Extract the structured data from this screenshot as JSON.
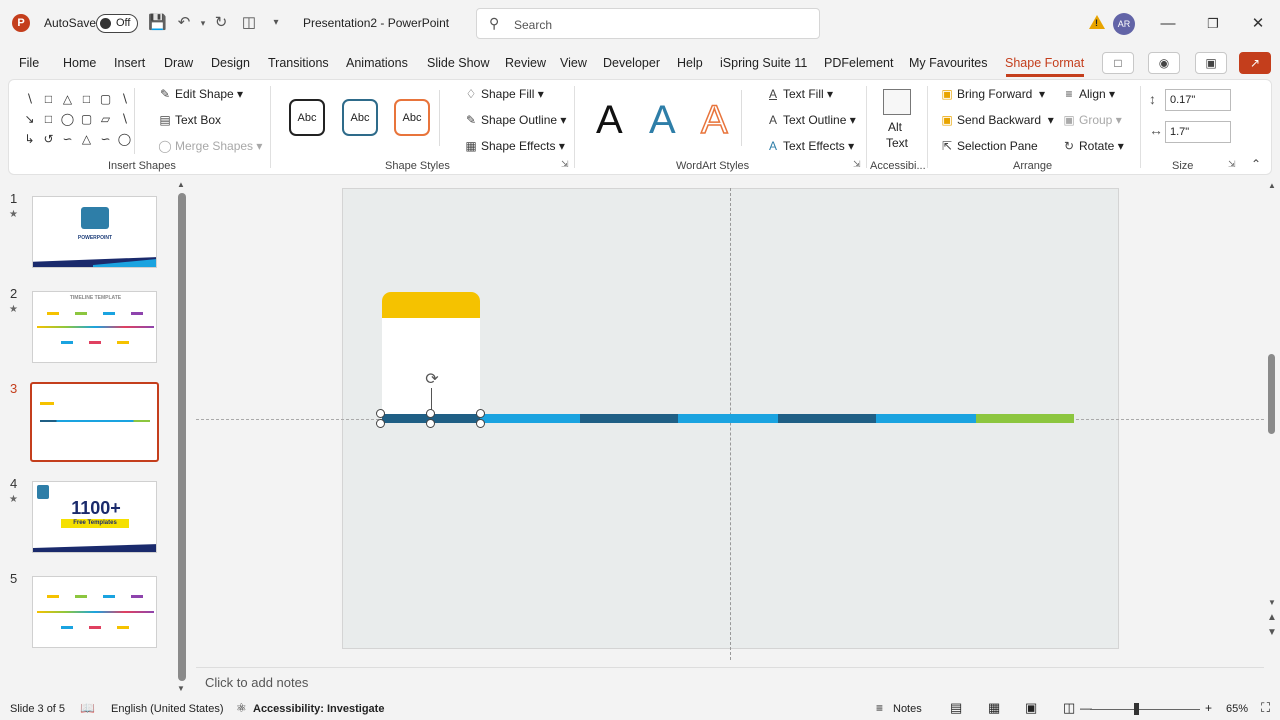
{
  "titlebar": {
    "autosave_label": "AutoSave",
    "autosave_state": "Off",
    "doc_title": "Presentation2 - PowerPoint",
    "search_placeholder": "Search",
    "avatar_initials": "AR",
    "warning_glyph": "!"
  },
  "tabs": [
    "File",
    "Home",
    "Insert",
    "Draw",
    "Design",
    "Transitions",
    "Animations",
    "Slide Show",
    "Review",
    "View",
    "Developer",
    "Help",
    "iSpring Suite 11",
    "PDFelement",
    "My Favourites",
    "Shape Format"
  ],
  "active_tab": "Shape Format",
  "ribbon": {
    "insert_shapes": {
      "label": "Insert Shapes",
      "edit_shape": "Edit Shape",
      "text_box": "Text Box",
      "merge_shapes": "Merge Shapes"
    },
    "shape_styles": {
      "label": "Shape Styles",
      "abc1": "Abc",
      "abc2": "Abc",
      "abc3": "Abc",
      "shape_fill": "Shape Fill",
      "shape_outline": "Shape Outline",
      "shape_effects": "Shape Effects"
    },
    "wordart": {
      "label": "WordArt Styles",
      "letter": "A",
      "text_fill": "Text Fill",
      "text_outline": "Text Outline",
      "text_effects": "Text Effects"
    },
    "accessibility": {
      "label": "Accessibi...",
      "alt_text_line1": "Alt",
      "alt_text_line2": "Text"
    },
    "arrange": {
      "label": "Arrange",
      "bring_forward": "Bring Forward",
      "send_backward": "Send Backward",
      "selection_pane": "Selection Pane",
      "align": "Align",
      "group": "Group",
      "rotate": "Rotate"
    },
    "size": {
      "label": "Size",
      "height": "0.17\"",
      "width": "1.7\""
    }
  },
  "slides": [
    {
      "num": "1",
      "star": "★"
    },
    {
      "num": "2",
      "star": "★",
      "thumb_title": "TIMELINE TEMPLATE"
    },
    {
      "num": "3",
      "star": ""
    },
    {
      "num": "4",
      "star": "★",
      "thumb_big": "1100+",
      "thumb_sub": "Free Templates"
    },
    {
      "num": "5",
      "star": ""
    }
  ],
  "thumb1_title": "POWERPOINT",
  "notes_placeholder": "Click to add notes",
  "status": {
    "slide_info": "Slide 3 of 5",
    "language": "English (United States)",
    "accessibility": "Accessibility: Investigate",
    "notes": "Notes",
    "zoom": "65%"
  },
  "colors": {
    "accent": "#c43e1c",
    "yellow": "#f5c200",
    "timeline_dark": "#1f5f85",
    "timeline_light": "#1aa3e0",
    "timeline_green": "#8cc63f"
  }
}
